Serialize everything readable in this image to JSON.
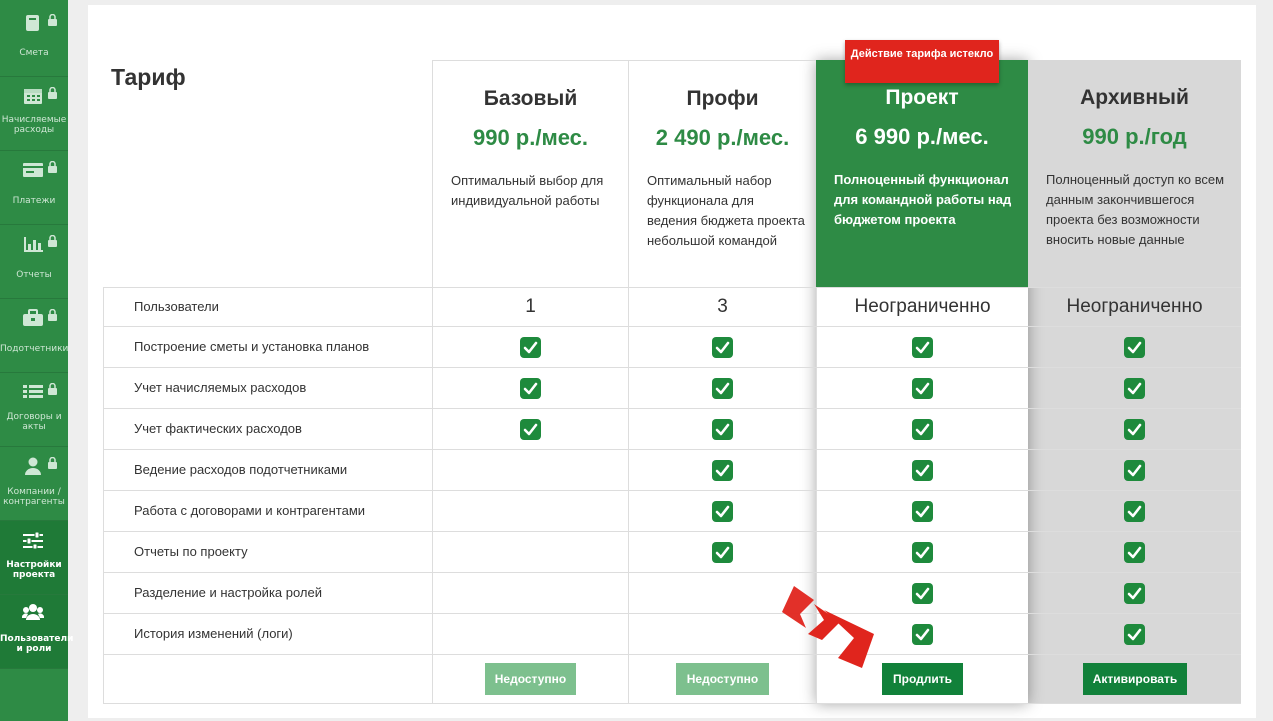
{
  "sidebar": {
    "items": [
      {
        "label": "Смета",
        "icon": "book-icon",
        "locked": true
      },
      {
        "label": "Начисляемые расходы",
        "icon": "calendar-icon",
        "locked": true
      },
      {
        "label": "Платежи",
        "icon": "payments-icon",
        "locked": true
      },
      {
        "label": "Отчеты",
        "icon": "bar-chart-icon",
        "locked": true
      },
      {
        "label": "Подотчетники",
        "icon": "briefcase-icon",
        "locked": true
      },
      {
        "label": "Договоры и акты",
        "icon": "list-icon",
        "locked": true
      },
      {
        "label": "Компании / контрагенты",
        "icon": "user-icon",
        "locked": true
      },
      {
        "label": "Настройки проекта",
        "icon": "sliders-icon",
        "locked": false,
        "active": true
      },
      {
        "label": "Пользователи и роли",
        "icon": "users-icon",
        "locked": false,
        "active": true
      }
    ]
  },
  "page": {
    "title": "Тариф"
  },
  "badge": {
    "text": "Действие тарифа истекло"
  },
  "plans": [
    {
      "name": "Базовый",
      "price": "990 р./мес.",
      "desc": "Оптимальный выбор для индивидуальной работы"
    },
    {
      "name": "Профи",
      "price": "2 490 р./мес.",
      "desc": "Оптимальный набор функционала для ведения бюджета проекта небольшой командой"
    },
    {
      "name": "Проект",
      "price": "6 990 р./мес.",
      "desc": "Полноценный функционал для командной работы над бюджетом проекта"
    },
    {
      "name": "Архивный",
      "price": "990 р./год",
      "desc": "Полноценный доступ ко всем данным закончившегося проекта без возможности вносить новые данные"
    }
  ],
  "users_row": {
    "label": "Пользователи",
    "values": [
      "1",
      "3",
      "Неограниченно",
      "Неограниченно"
    ]
  },
  "features": [
    {
      "label": "Построение сметы и установка планов",
      "checks": [
        true,
        true,
        true,
        true
      ]
    },
    {
      "label": "Учет начисляемых расходов",
      "checks": [
        true,
        true,
        true,
        true
      ]
    },
    {
      "label": "Учет фактических расходов",
      "checks": [
        true,
        true,
        true,
        true
      ]
    },
    {
      "label": "Ведение расходов подотчетниками",
      "checks": [
        false,
        true,
        true,
        true
      ]
    },
    {
      "label": "Работа с договорами и контрагентами",
      "checks": [
        false,
        true,
        true,
        true
      ]
    },
    {
      "label": "Отчеты по проекту",
      "checks": [
        false,
        true,
        true,
        true
      ]
    },
    {
      "label": "Разделение и настройка ролей",
      "checks": [
        false,
        false,
        true,
        true
      ]
    },
    {
      "label": "История изменений (логи)",
      "checks": [
        false,
        false,
        true,
        true
      ]
    }
  ],
  "buttons": [
    "Недоступно",
    "Недоступно",
    "Продлить",
    "Активировать"
  ],
  "colors": {
    "green": "#2e8b45",
    "check": "#1e8a3c",
    "red": "#e0251d",
    "archive_gray": "#d8d8d8"
  }
}
